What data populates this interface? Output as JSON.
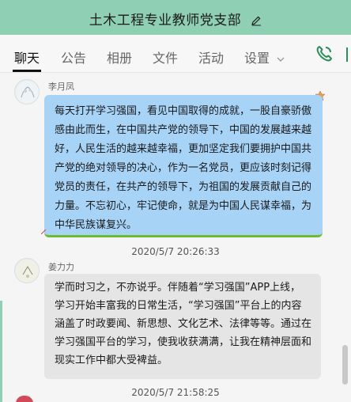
{
  "window": {
    "title": "土木工程专业教师党支部"
  },
  "tabs": [
    {
      "label": "聊天",
      "active": true
    },
    {
      "label": "公告",
      "active": false
    },
    {
      "label": "相册",
      "active": false
    },
    {
      "label": "文件",
      "active": false
    },
    {
      "label": "活动",
      "active": false
    },
    {
      "label": "设置",
      "active": false,
      "has_dropdown": true
    }
  ],
  "icons": {
    "edit": "pencil-icon",
    "call": "phone-icon",
    "dropdown": "chevron-down-icon",
    "close": "close-icon"
  },
  "colors": {
    "titlebar": "#8fcfb4",
    "bubble_self": "#a7d3f6",
    "bubble_other": "#e5e5e5",
    "accent_green": "#2a8f5c"
  },
  "messages": [
    {
      "sender": "李月凤",
      "lines": [
        "每天打开学习强国，看见中国取得的成就，一股自豪骄傲",
        "感由此而生，在中国共产党的领导下，中国的发展越来越",
        "好，人民生活的越来越幸福，更加坚定我们要拥护中国共",
        "产党的绝对领导的决心，作为一名党员，更应该时刻记得",
        "党员的责任，在共产的领导下，为祖国的发展贡献自己的",
        "力量。不忘初心，牢记使命，就是为中国人民谋幸福，为",
        "中华民族谋复兴。"
      ],
      "timestamp": "2020/5/7 20:26:33"
    },
    {
      "sender": "姜力力",
      "lines": [
        "学而时习之，不亦说乎。伴随着“学习强国”APP上线，",
        "学习开始丰富我的日常生活，“学习强国”平台上的内容",
        "涵盖了时政要闻、新思想、文化艺术、法律等等。通过在",
        "学习强国平台的学习，使我收获满满，让我在精神层面和",
        "现实工作中都大受裨益。"
      ],
      "timestamp": "2020/5/7 21:58:25"
    }
  ]
}
